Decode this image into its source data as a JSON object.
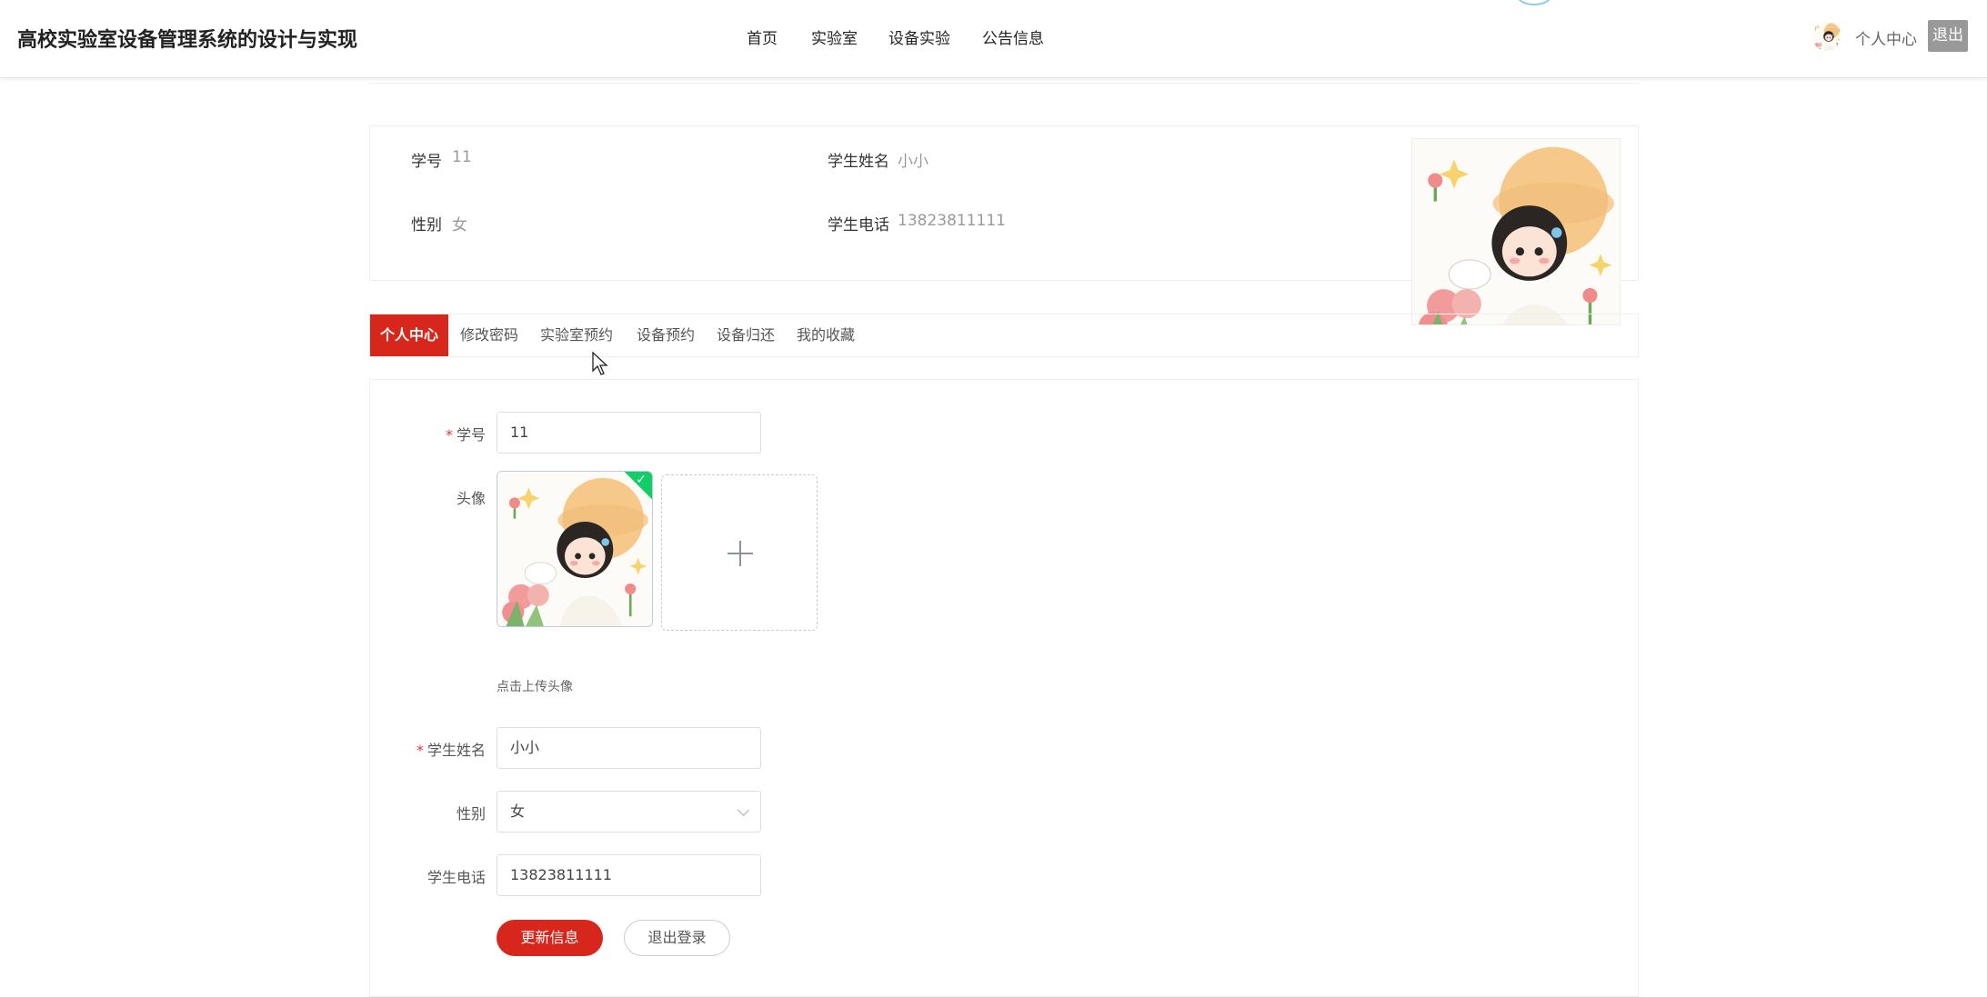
{
  "header": {
    "title": "高校实验室设备管理系统的设计与实现",
    "nav": [
      "首页",
      "实验室",
      "设备实验",
      "公告信息"
    ],
    "user_center": "个人中心",
    "logout": "退出"
  },
  "profile": {
    "student_id_label": "学号",
    "student_id": "11",
    "name_label": "学生姓名",
    "name": "小小",
    "gender_label": "性别",
    "gender": "女",
    "phone_label": "学生电话",
    "phone": "13823811111"
  },
  "tabs": [
    "个人中心",
    "修改密码",
    "实验室预约",
    "设备预约",
    "设备归还",
    "我的收藏"
  ],
  "form": {
    "student_id_label": "学号",
    "student_id": "11",
    "avatar_label": "头像",
    "upload_hint": "点击上传头像",
    "name_label": "学生姓名",
    "name": "小小",
    "gender_label": "性别",
    "gender": "女",
    "phone_label": "学生电话",
    "phone": "13823811111",
    "update_button": "更新信息",
    "logout_button": "退出登录",
    "required_mark": "*"
  },
  "colors": {
    "accent": "#d7261b",
    "success": "#13ce66"
  }
}
